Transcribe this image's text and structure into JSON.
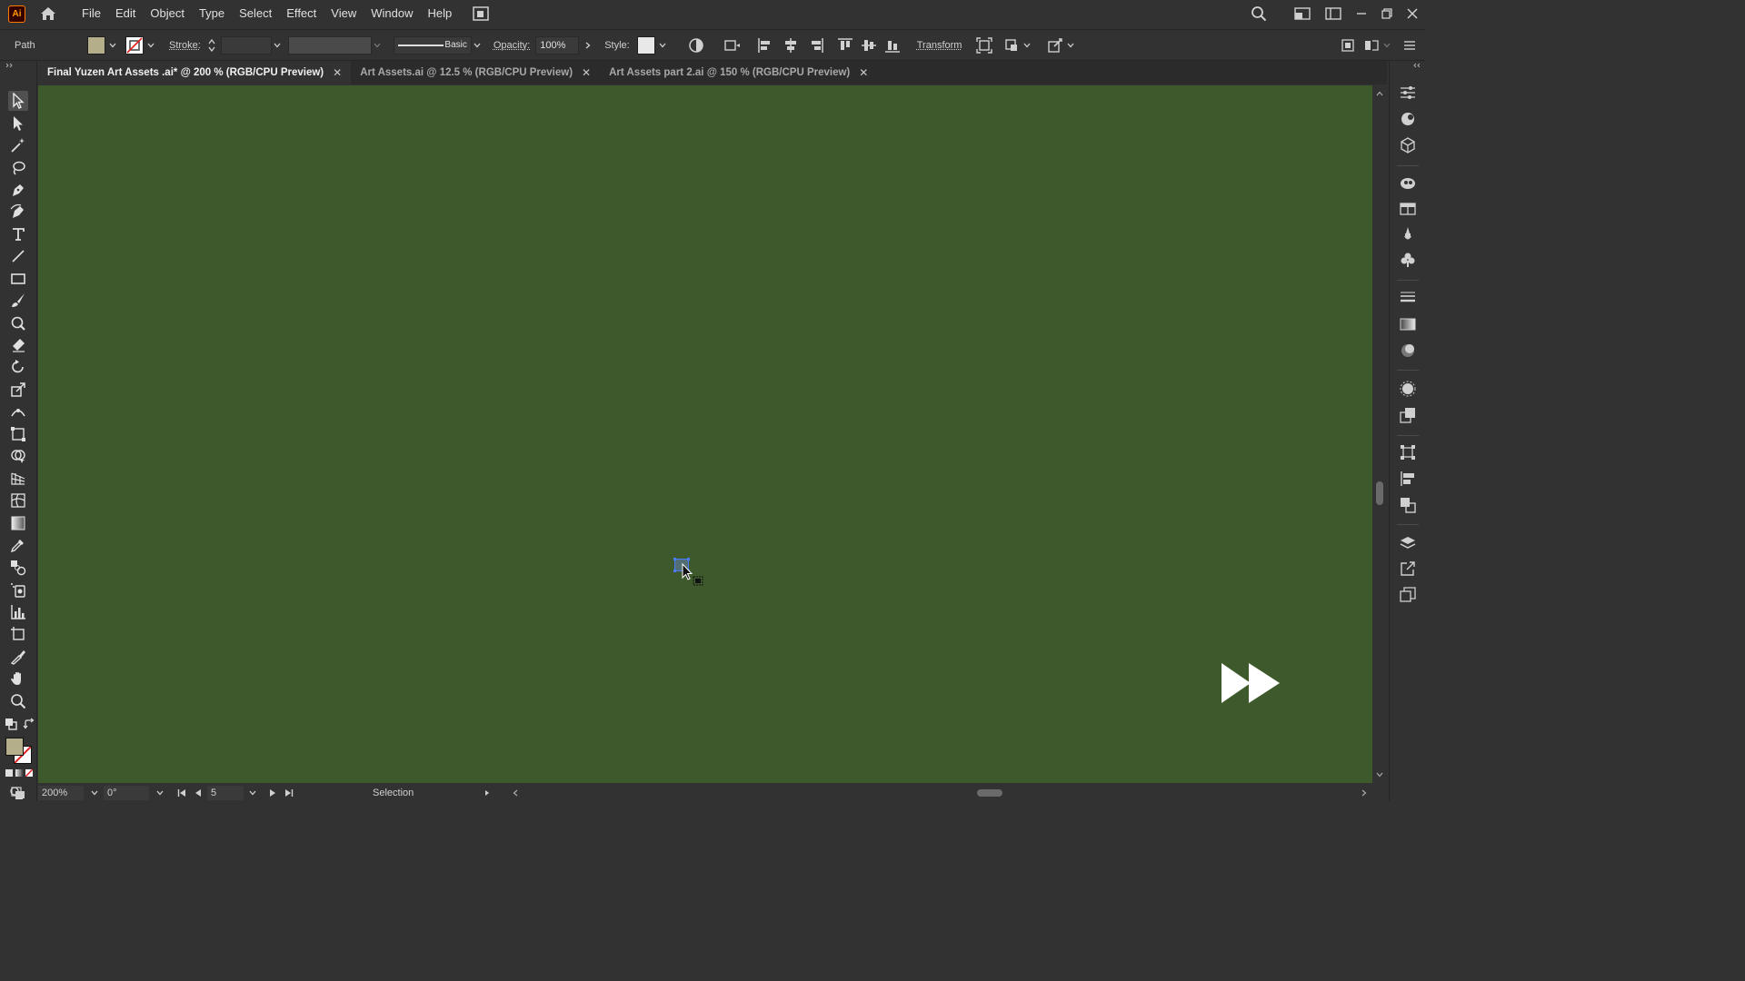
{
  "app": {
    "logo_text": "Ai"
  },
  "menu": {
    "items": [
      "File",
      "Edit",
      "Object",
      "Type",
      "Select",
      "Effect",
      "View",
      "Window",
      "Help"
    ]
  },
  "controlbar": {
    "object_type": "Path",
    "fill_color": "#b5ae8a",
    "stroke_label": "Stroke:",
    "stroke_profile": "Basic",
    "opacity_label": "Opacity:",
    "opacity_value": "100%",
    "style_label": "Style:",
    "transform_label": "Transform"
  },
  "tabs": [
    {
      "label": "Final Yuzen Art Assets .ai* @ 200 % (RGB/CPU Preview)",
      "active": true
    },
    {
      "label": "Art Assets.ai @ 12.5 % (RGB/CPU Preview)",
      "active": false
    },
    {
      "label": "Art Assets part 2.ai @ 150 % (RGB/CPU Preview)",
      "active": false
    }
  ],
  "canvas": {
    "background": "#3e5a2c"
  },
  "statusbar": {
    "zoom": "200%",
    "rotation": "0°",
    "artboard": "5",
    "tool_name": "Selection"
  },
  "colors": {
    "accent_selection": "#4a7cff",
    "chrome": "#323232"
  }
}
